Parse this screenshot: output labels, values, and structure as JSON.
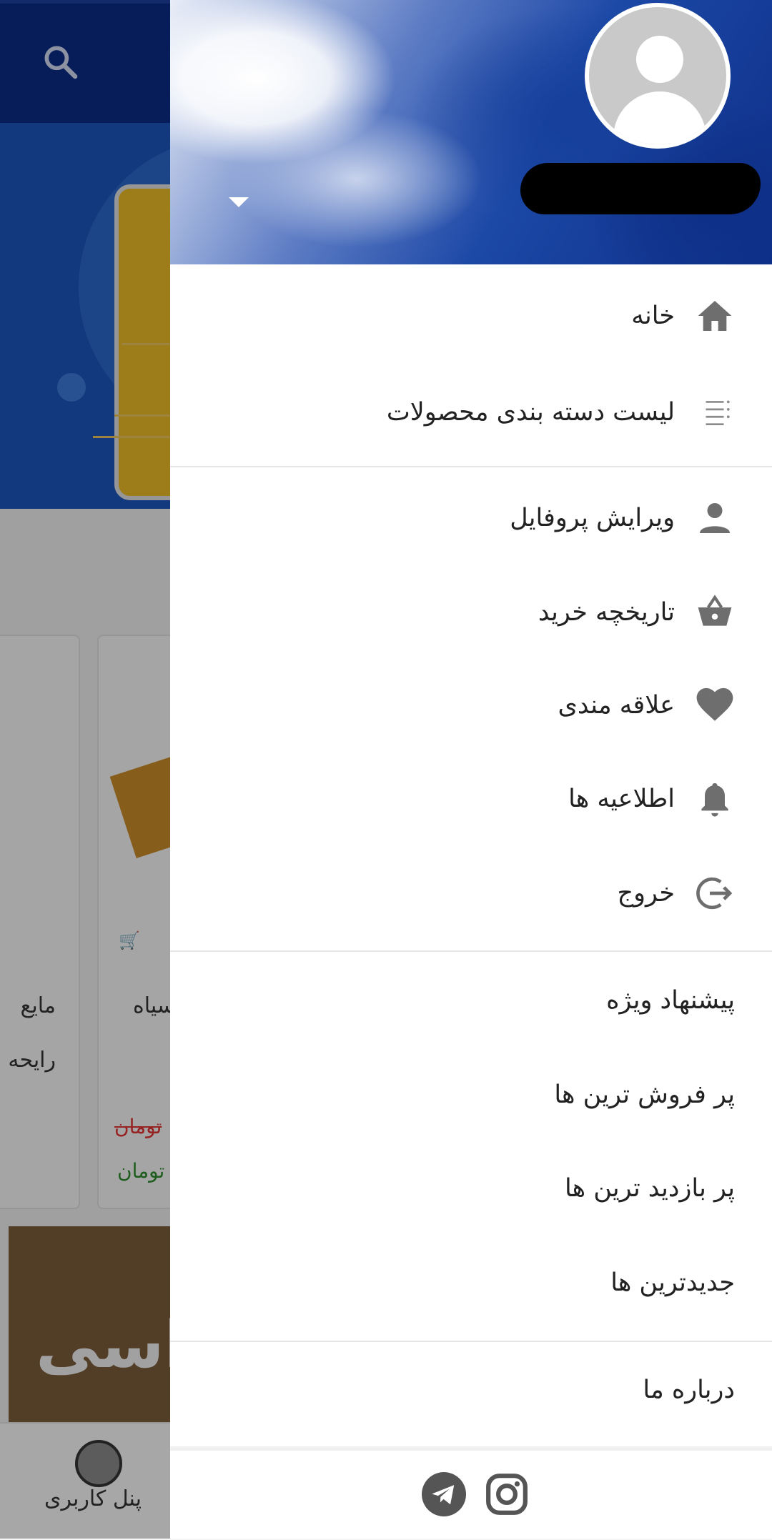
{
  "background": {
    "bottom_nav": {
      "user_panel_label": "پنل کاربری"
    },
    "products": [
      {
        "title_line1": "مایع",
        "title_line2": "رایحه"
      },
      {
        "title_line1": "سیاه",
        "old_price": "تومان",
        "price": "تومان"
      }
    ],
    "banner_text": "اسی"
  },
  "drawer": {
    "menu": [
      {
        "label": "خانه",
        "icon": "home-icon"
      },
      {
        "label": "لیست دسته بندی محصولات",
        "icon": "category-list-icon"
      },
      {
        "label": "ویرایش پروفایل",
        "icon": "person-icon"
      },
      {
        "label": "تاریخچه خرید",
        "icon": "basket-icon"
      },
      {
        "label": "علاقه مندی",
        "icon": "heart-icon"
      },
      {
        "label": "اطلاعیه ها",
        "icon": "bell-icon"
      },
      {
        "label": "خروج",
        "icon": "logout-icon"
      },
      {
        "label": "پیشنهاد ویژه"
      },
      {
        "label": "پر فروش ترین ها"
      },
      {
        "label": "پر بازدید ترین ها"
      },
      {
        "label": "جدیدترین ها"
      },
      {
        "label": "درباره ما"
      }
    ],
    "social": [
      "telegram-icon",
      "instagram-icon"
    ]
  },
  "colors": {
    "header_blue": "#0a2c84",
    "icon_gray": "#6e6e6e",
    "text": "#222222"
  }
}
